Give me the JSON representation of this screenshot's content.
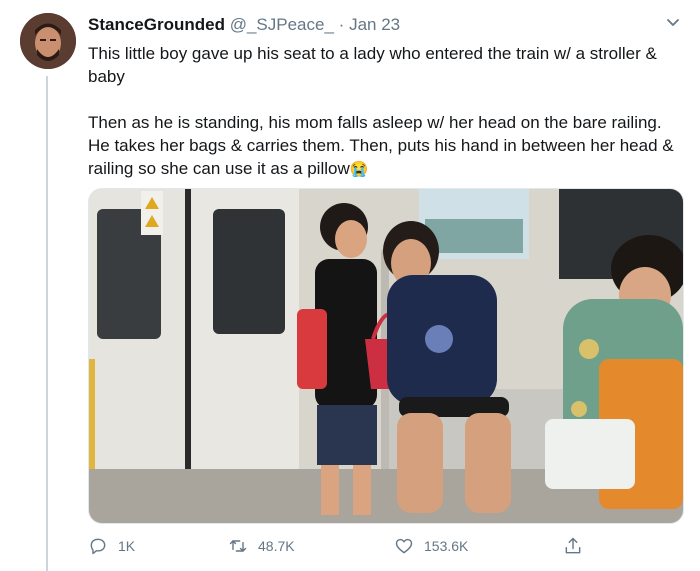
{
  "tweet": {
    "display_name": "StanceGrounded",
    "handle": "@_SJPeace_",
    "separator": "·",
    "date": "Jan 23",
    "text_line1": "This little boy gave up his seat to a lady who entered the train w/ a stroller & baby",
    "text_line2": "Then as he is standing, his mom falls asleep w/ her head on the bare railing. He takes her bags & carries them. Then, puts his hand in between her head & railing so she can use it as a pillow",
    "emoji": "😭",
    "photo_icon": "photo-train-boy-mother",
    "actions": {
      "reply_count": "1K",
      "retweet_count": "48.7K",
      "like_count": "153.6K"
    }
  },
  "icons": {
    "caret": "chevron-down-icon",
    "reply": "reply-icon",
    "retweet": "retweet-icon",
    "like": "heart-icon",
    "share": "share-icon"
  },
  "colors": {
    "text": "#14171a",
    "muted": "#657786",
    "border": "#e1e8ed"
  }
}
